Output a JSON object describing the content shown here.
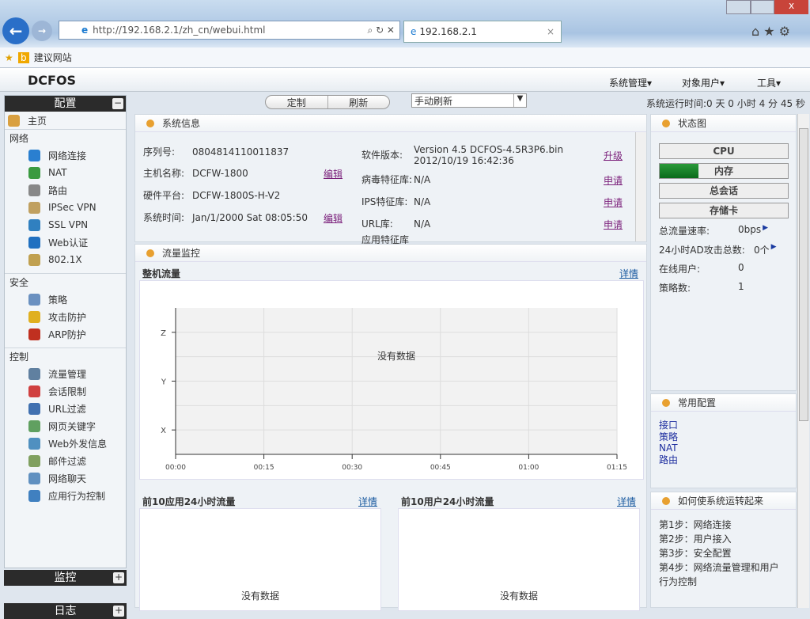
{
  "browser": {
    "url": "http://192.168.2.1/zh_cn/webui.html",
    "tab_title": "192.168.2.1",
    "favorites": "建议网站"
  },
  "header": {
    "logo": "DCFOS",
    "menus": [
      "系统管理▾",
      "对象用户▾",
      "工具▾"
    ]
  },
  "toolbar": {
    "customize": "定制",
    "refresh": "刷新",
    "refresh_mode": "手动刷新",
    "uptime": "系统运行时间:0 天 0 小时 4 分 45 秒"
  },
  "sidebar": {
    "title": "配置",
    "home": "主页",
    "groups": [
      {
        "label": "网络",
        "items": [
          "网络连接",
          "NAT",
          "路由",
          "IPSec VPN",
          "SSL VPN",
          "Web认证",
          "802.1X"
        ]
      },
      {
        "label": "安全",
        "items": [
          "策略",
          "攻击防护",
          "ARP防护"
        ]
      },
      {
        "label": "控制",
        "items": [
          "流量管理",
          "会话限制",
          "URL过滤",
          "网页关键字",
          "Web外发信息",
          "邮件过滤",
          "网络聊天",
          "应用行为控制"
        ]
      }
    ],
    "monitor": "监控",
    "log": "日志"
  },
  "sysinfo": {
    "title": "系统信息",
    "left": [
      {
        "label": "序列号:",
        "value": "0804814110011837",
        "action": ""
      },
      {
        "label": "主机名称:",
        "value": "DCFW-1800",
        "action": "编辑"
      },
      {
        "label": "硬件平台:",
        "value": "DCFW-1800S-H-V2",
        "action": ""
      },
      {
        "label": "系统时间:",
        "value": "Jan/1/2000  Sat  08:05:50",
        "action": "编辑"
      }
    ],
    "right": [
      {
        "label": "软件版本:",
        "value": "Version 4.5 DCFOS-4.5R3P6.bin 2012/10/19 16:42:36",
        "action": "升级"
      },
      {
        "label": "病毒特征库:",
        "value": "N/A",
        "action": "申请"
      },
      {
        "label": "IPS特征库:",
        "value": "N/A",
        "action": "申请"
      },
      {
        "label": "URL库:",
        "value": "N/A",
        "action": "申请"
      },
      {
        "label": "应用特征库",
        "value": "",
        "action": ""
      }
    ]
  },
  "traffic": {
    "title": "流量监控",
    "overall": "整机流量",
    "detail": "详情",
    "no_data": "没有数据",
    "top_apps": "前10应用24小时流量",
    "top_users": "前10用户24小时流量"
  },
  "chart_data": {
    "type": "line",
    "title": "整机流量",
    "x_ticks": [
      "00:00",
      "00:15",
      "00:30",
      "00:45",
      "01:00",
      "01:15"
    ],
    "y_ticks": [
      "X",
      "Y",
      "Z"
    ],
    "series": [],
    "annotation": "没有数据",
    "grid": true
  },
  "status": {
    "title": "状态图",
    "bars": [
      {
        "label": "CPU",
        "fill": 0
      },
      {
        "label": "内存",
        "fill": 0.3
      },
      {
        "label": "总会话",
        "fill": 0
      },
      {
        "label": "存储卡",
        "fill": 0
      }
    ],
    "stats": [
      {
        "label": "总流量速率:",
        "value": "0bps"
      },
      {
        "label": "24小时AD攻击总数:",
        "value": "0个"
      },
      {
        "label": "在线用户:",
        "value": "0"
      },
      {
        "label": "策略数:",
        "value": "1"
      }
    ]
  },
  "common": {
    "title": "常用配置",
    "links": [
      "接口",
      "策略",
      "NAT",
      "路由"
    ]
  },
  "howto": {
    "title": "如何使系统运转起来",
    "steps": [
      "第1步：网络连接",
      "第2步：用户接入",
      "第3步：安全配置",
      "第4步：网络流量管理和用户行为控制"
    ]
  }
}
